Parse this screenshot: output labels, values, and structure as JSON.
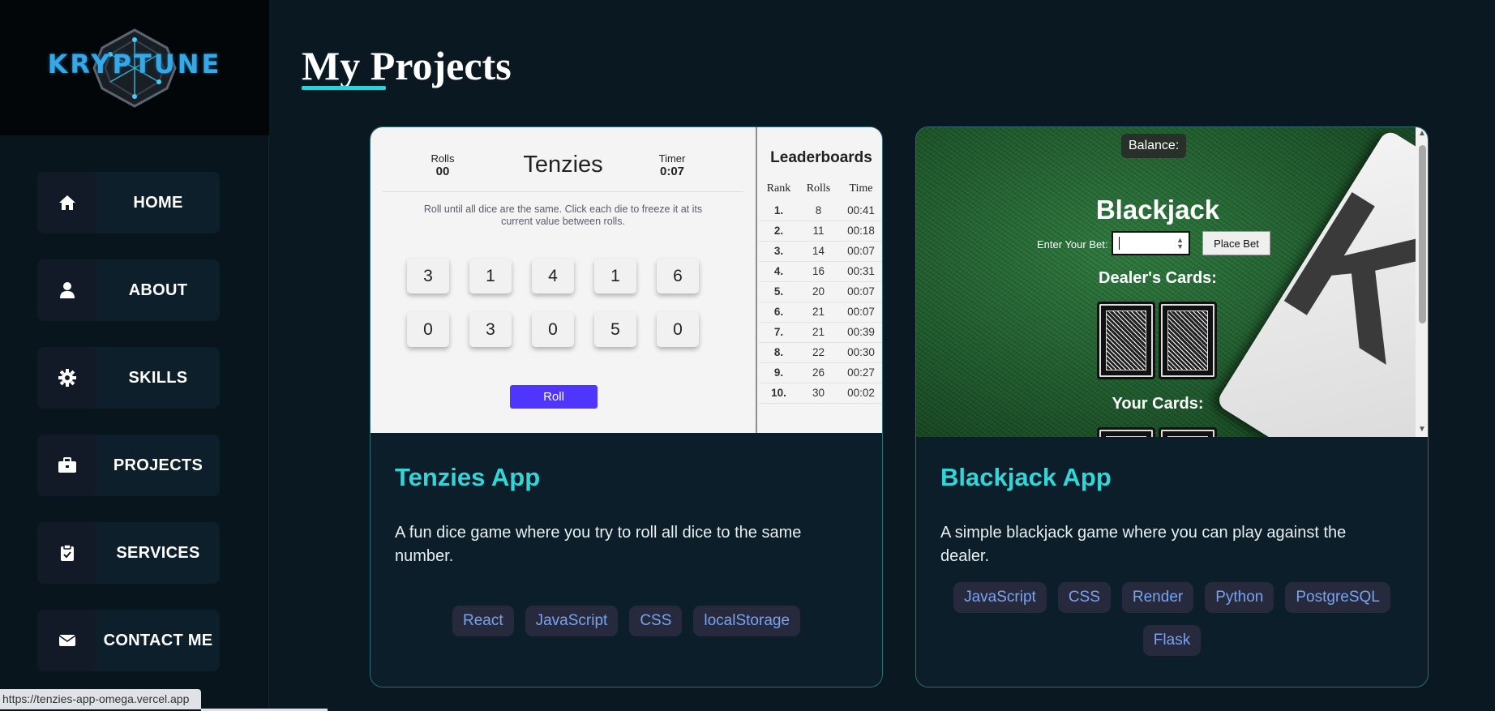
{
  "sidebar": {
    "logo_text": "KRYPTUNE",
    "items": [
      {
        "label": "HOME",
        "icon": "home-icon"
      },
      {
        "label": "ABOUT",
        "icon": "user-icon"
      },
      {
        "label": "SKILLS",
        "icon": "gear-icon"
      },
      {
        "label": "PROJECTS",
        "icon": "briefcase-icon"
      },
      {
        "label": "SERVICES",
        "icon": "clipboard-icon"
      },
      {
        "label": "CONTACT ME",
        "icon": "envelope-icon"
      }
    ]
  },
  "page": {
    "title": "My Projects",
    "accent_color": "#2fd1d6"
  },
  "projects": [
    {
      "title": "Tenzies App",
      "description": "A fun dice game where you try to roll all dice to the same number.",
      "tags": [
        "React",
        "JavaScript",
        "CSS",
        "localStorage"
      ],
      "preview": {
        "rolls_label": "Rolls",
        "rolls_value": "00",
        "game_title": "Tenzies",
        "timer_label": "Timer",
        "timer_value": "0:07",
        "instructions": "Roll until all dice are the same. Click each die to freeze it at its current value between rolls.",
        "dice_row1": [
          "3",
          "1",
          "4",
          "1",
          "6"
        ],
        "dice_row2": [
          "0",
          "3",
          "0",
          "5",
          "0"
        ],
        "roll_button": "Roll",
        "leaderboard": {
          "title": "Leaderboards",
          "headers": [
            "Rank",
            "Rolls",
            "Time"
          ],
          "rows": [
            [
              "1.",
              "8",
              "00:41"
            ],
            [
              "2.",
              "11",
              "00:18"
            ],
            [
              "3.",
              "14",
              "00:07"
            ],
            [
              "4.",
              "16",
              "00:31"
            ],
            [
              "5.",
              "20",
              "00:07"
            ],
            [
              "6.",
              "21",
              "00:07"
            ],
            [
              "7.",
              "21",
              "00:39"
            ],
            [
              "8.",
              "22",
              "00:30"
            ],
            [
              "9.",
              "26",
              "00:27"
            ],
            [
              "10.",
              "30",
              "00:02"
            ]
          ]
        }
      }
    },
    {
      "title": "Blackjack App",
      "description": "A simple blackjack game where you can play against the dealer.",
      "tags": [
        "JavaScript",
        "CSS",
        "Render",
        "Python",
        "PostgreSQL",
        "Flask"
      ],
      "preview": {
        "balance_label": "Balance:",
        "game_title": "Blackjack",
        "bet_label": "Enter Your Bet:",
        "place_bet_button": "Place Bet",
        "dealer_cards_label": "Dealer's Cards:",
        "your_cards_label": "Your Cards:",
        "big_card_letter": "K"
      }
    }
  ],
  "status_bar": {
    "url": "https://tenzies-app-omega.vercel.app"
  }
}
